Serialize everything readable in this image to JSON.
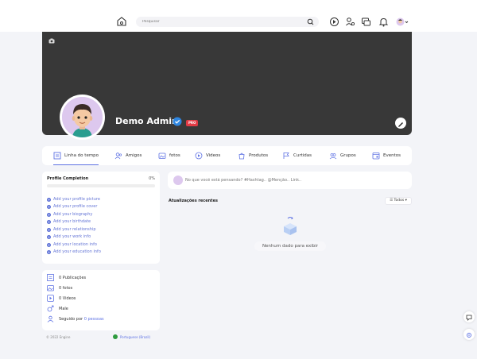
{
  "header": {
    "search_placeholder": "Pesquisar",
    "icons": [
      "home-icon",
      "search-icon",
      "add-icon",
      "friends-icon",
      "messages-icon",
      "notifications-icon",
      "avatar-icon"
    ]
  },
  "profile": {
    "name": "Demo Admin",
    "badge": "PRO",
    "accent": "#5e72e4"
  },
  "tabs": [
    {
      "label": "Linha do tempo",
      "icon": "timeline-icon"
    },
    {
      "label": "Amigos",
      "icon": "friends-icon"
    },
    {
      "label": "fotos",
      "icon": "photos-icon"
    },
    {
      "label": "Videos",
      "icon": "videos-icon"
    },
    {
      "label": "Produtos",
      "icon": "products-icon"
    },
    {
      "label": "Curtidas",
      "icon": "likes-icon"
    },
    {
      "label": "Grupos",
      "icon": "groups-icon"
    },
    {
      "label": "Eventos",
      "icon": "events-icon"
    }
  ],
  "completion": {
    "title": "Profile Completion",
    "percent": "0%",
    "progress": 0,
    "items": [
      "Add your profile picture",
      "Add your profile cover",
      "Add your biography",
      "Add your birthdate",
      "Add your relationship",
      "Add your work info",
      "Add your location info",
      "Add your education info"
    ]
  },
  "stats": {
    "posts": "0 Publicações",
    "photos": "0 fotos",
    "videos": "0 Videos",
    "gender": "Male",
    "followed_prefix": "Seguido por",
    "followed_link": "0 pessoas"
  },
  "footer": {
    "copyright": "© 2022 Engine",
    "language": "Portuguese (Brazil)"
  },
  "feed": {
    "post_placeholder": "No que você está pensando? #Hashtag.. @Menção.. Link..",
    "updates_title": "Atualizações recentes",
    "filter_label": "☰ Todos ▾",
    "empty_text": "Nenhum dado para exibir"
  }
}
